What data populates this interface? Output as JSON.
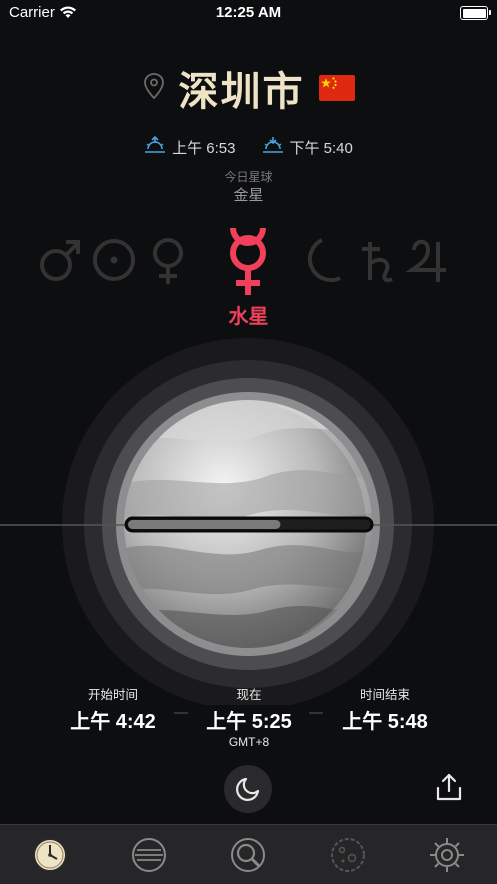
{
  "status_bar": {
    "carrier": "Carrier",
    "time": "12:25 AM"
  },
  "header": {
    "city": "深圳市",
    "flag_icon": "china-flag-icon",
    "location_icon": "location-pin-icon"
  },
  "sun": {
    "sunrise": "上午 6:53",
    "sunset": "下午 5:40",
    "accent_color": "#4aa3df"
  },
  "today": {
    "label": "今日星球",
    "planet": "金星"
  },
  "planets_row": [
    "♂",
    "☉",
    "♀",
    "☿",
    "☽",
    "♄",
    "♃"
  ],
  "current_planet": {
    "name": "水星",
    "color": "#f0405c"
  },
  "progress": {
    "fraction": 0.63
  },
  "times": {
    "start_label": "开始时间",
    "start_value": "上午 4:42",
    "now_label": "现在",
    "now_value": "上午 5:25",
    "timezone": "GMT+8",
    "end_label": "时间结束",
    "end_value": "上午 5:48"
  },
  "buttons": {
    "night_icon": "moon-icon",
    "share_icon": "share-icon"
  },
  "tabbar": {
    "items": [
      "clock-icon",
      "list-icon",
      "search-icon",
      "planet-icon",
      "settings-icon"
    ],
    "active": 0
  }
}
